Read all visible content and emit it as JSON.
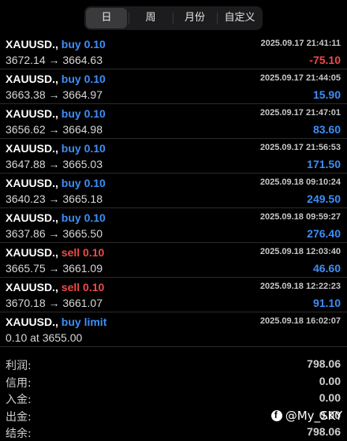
{
  "tabs": [
    {
      "label": "日",
      "active": true
    },
    {
      "label": "周",
      "active": false
    },
    {
      "label": "月份",
      "active": false
    },
    {
      "label": "自定义",
      "active": false
    }
  ],
  "orders": [
    {
      "symbol": "XAUUSD.,",
      "side": "buy 0.10",
      "side_type": "buy",
      "time": "2025.09.17 21:41:11",
      "prices": "3672.14 → 3664.63",
      "profit": "-75.10",
      "profit_sign": "neg"
    },
    {
      "symbol": "XAUUSD.,",
      "side": "buy 0.10",
      "side_type": "buy",
      "time": "2025.09.17 21:44:05",
      "prices": "3663.38 → 3664.97",
      "profit": "15.90",
      "profit_sign": "pos"
    },
    {
      "symbol": "XAUUSD.,",
      "side": "buy 0.10",
      "side_type": "buy",
      "time": "2025.09.17 21:47:01",
      "prices": "3656.62 → 3664.98",
      "profit": "83.60",
      "profit_sign": "pos"
    },
    {
      "symbol": "XAUUSD.,",
      "side": "buy 0.10",
      "side_type": "buy",
      "time": "2025.09.17 21:56:53",
      "prices": "3647.88 → 3665.03",
      "profit": "171.50",
      "profit_sign": "pos"
    },
    {
      "symbol": "XAUUSD.,",
      "side": "buy 0.10",
      "side_type": "buy",
      "time": "2025.09.18 09:10:24",
      "prices": "3640.23 → 3665.18",
      "profit": "249.50",
      "profit_sign": "pos"
    },
    {
      "symbol": "XAUUSD.,",
      "side": "buy 0.10",
      "side_type": "buy",
      "time": "2025.09.18 09:59:27",
      "prices": "3637.86 → 3665.50",
      "profit": "276.40",
      "profit_sign": "pos"
    },
    {
      "symbol": "XAUUSD.,",
      "side": "sell 0.10",
      "side_type": "sell",
      "time": "2025.09.18 12:03:40",
      "prices": "3665.75 → 3661.09",
      "profit": "46.60",
      "profit_sign": "pos"
    },
    {
      "symbol": "XAUUSD.,",
      "side": "sell 0.10",
      "side_type": "sell",
      "time": "2025.09.18 12:22:23",
      "prices": "3670.18 → 3661.07",
      "profit": "91.10",
      "profit_sign": "pos"
    },
    {
      "symbol": "XAUUSD.,",
      "side": "buy limit",
      "side_type": "buy",
      "time": "2025.09.18 16:02:07",
      "prices": "0.10 at 3655.00",
      "profit": "",
      "profit_sign": "pos"
    }
  ],
  "summary": [
    {
      "label": "利润:",
      "value": "798.06"
    },
    {
      "label": "信用:",
      "value": "0.00"
    },
    {
      "label": "入金:",
      "value": "0.00"
    },
    {
      "label": "出金:",
      "value": "0.00"
    },
    {
      "label": "结余:",
      "value": "798.06"
    }
  ],
  "watermark": {
    "text": "@My_SKY",
    "icon": "facebook-icon"
  },
  "colors": {
    "buy": "#3d8ef7",
    "sell": "#f04a4a",
    "background": "#000000"
  }
}
